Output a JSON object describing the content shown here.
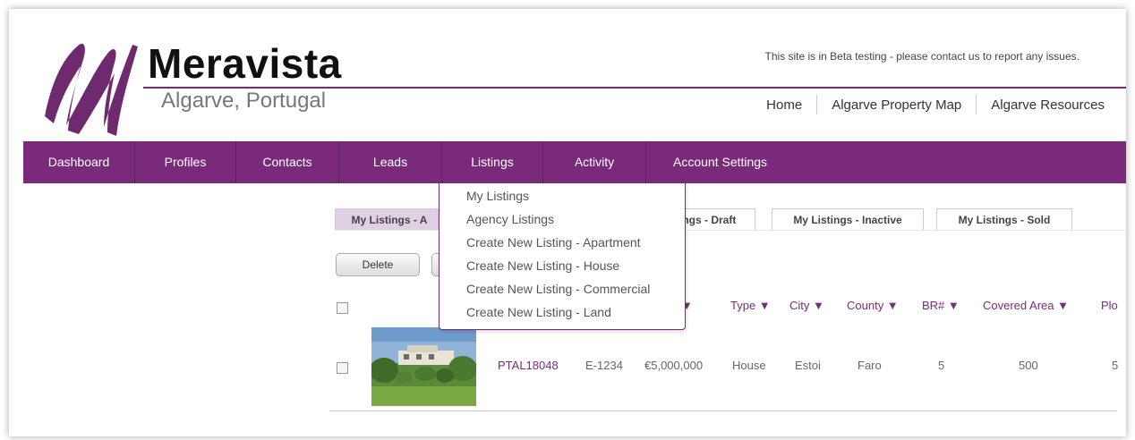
{
  "brand": {
    "name": "Meravista",
    "tagline": "Algarve, Portugal"
  },
  "beta_notice": "This site is in Beta testing - please contact us to report any issues.",
  "top_links": [
    "Home",
    "Algarve Property Map",
    "Algarve Resources"
  ],
  "nav": [
    "Dashboard",
    "Profiles",
    "Contacts",
    "Leads",
    "Listings",
    "Activity",
    "Account Settings"
  ],
  "tabs": [
    "My Listings - A",
    "ings - Draft",
    "My Listings - Inactive",
    "My Listings - Sold"
  ],
  "buttons": {
    "delete": "Delete"
  },
  "dropdown": [
    "My Listings",
    "Agency Listings",
    "Create New Listing - Apartment",
    "Create New Listing - House",
    "Create New Listing - Commercial",
    "Create New Listing - Land"
  ],
  "table": {
    "headers": [
      "e ▼",
      "Type ▼",
      "City ▼",
      "County ▼",
      "BR# ▼",
      "Covered Area ▼",
      "Plo"
    ],
    "row": [
      "PTAL18048",
      "E-1234",
      "€5,000,000",
      "House",
      "Estoi",
      "Faro",
      "5",
      "500",
      "5"
    ]
  },
  "colors": {
    "brand_purple": "#7a2a7a",
    "active_tab": "#e0d0e4"
  }
}
